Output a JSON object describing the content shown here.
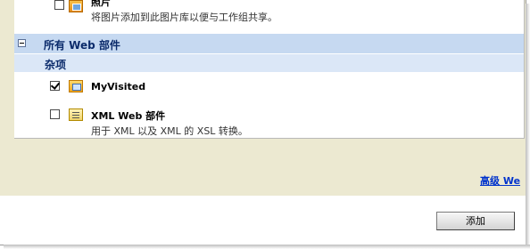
{
  "items": {
    "photo": {
      "title": "照片",
      "description": "将图片添加到此图片库以便与工作组共享。",
      "checked": false,
      "icon": "image-icon"
    },
    "my_visited": {
      "title": "MyVisited",
      "checked": true,
      "icon": "web-part-icon"
    },
    "xml_web_part": {
      "title": "XML Web 部件",
      "description": "用于 XML 以及 XML 的 XSL 转换。",
      "checked": false,
      "icon": "xml-icon"
    }
  },
  "group": {
    "title": "所有 Web 部件",
    "collapse_icon": "minus-icon"
  },
  "subgroup": {
    "title": "杂项"
  },
  "advanced_link": "高级 We",
  "add_button": "添加",
  "colors": {
    "header_bg": "#c6d9f1",
    "panel_bg": "#ece9d1",
    "link": "#0033cc"
  }
}
